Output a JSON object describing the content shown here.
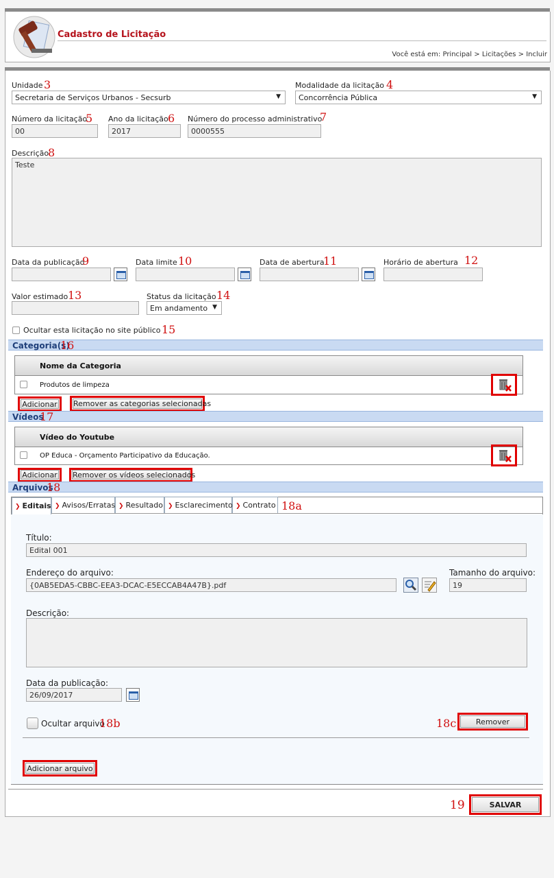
{
  "header": {
    "title": "Cadastro de Licitação",
    "breadcrumb": "Você está em: Principal > Licitações > Incluir"
  },
  "form": {
    "unidade": {
      "label": "Unidade",
      "value": "Secretaria de Serviços Urbanos - Secsurb"
    },
    "modalidade": {
      "label": "Modalidade da licitação",
      "value": "Concorrência Pública"
    },
    "numero": {
      "label": "Número da licitação",
      "value": "00"
    },
    "ano": {
      "label": "Ano da licitação",
      "value": "2017"
    },
    "processo": {
      "label": "Número do processo administrativo",
      "value": "0000555"
    },
    "descricao": {
      "label": "Descrição",
      "value": "Teste"
    },
    "data_publicacao": {
      "label": "Data da publicação",
      "value": ""
    },
    "data_limite": {
      "label": "Data limite",
      "value": ""
    },
    "data_abertura": {
      "label": "Data de abertura",
      "value": ""
    },
    "horario_abertura": {
      "label": "Horário de abertura",
      "value": ""
    },
    "valor_estimado": {
      "label": "Valor estimado",
      "value": ""
    },
    "status": {
      "label": "Status da licitação",
      "value": "Em andamento"
    },
    "ocultar": {
      "label": "Ocultar esta licitação no site público"
    }
  },
  "categorias": {
    "section": "Categoria(s)",
    "header": "Nome da Categoria",
    "rows": [
      "Produtos de limpeza"
    ],
    "add_button": "Adicionar",
    "remove_button": "Remover as categorias selecionadas"
  },
  "videos": {
    "section": "Vídeos",
    "header": "Vídeo do Youtube",
    "rows": [
      "OP Educa - Orçamento Participativo da Educação."
    ],
    "add_button": "Adicionar",
    "remove_button": "Remover os vídeos selecionados"
  },
  "arquivos": {
    "section": "Arquivos",
    "tabs": [
      "Editais",
      "Avisos/Erratas",
      "Resultado",
      "Esclarecimento",
      "Contrato"
    ],
    "titulo_label": "Título:",
    "titulo_value": "Edital 001",
    "endereco_label": "Endereço do arquivo:",
    "endereco_value": "{0AB5EDA5-CBBC-EEA3-DCAC-E5ECCAB4A47B}.pdf",
    "tamanho_label": "Tamanho do arquivo:",
    "tamanho_value": "19",
    "descricao_label": "Descrição:",
    "data_label": "Data da publicação:",
    "data_value": "26/09/2017",
    "ocultar_label": "Ocultar arquivo",
    "remover_button": "Remover",
    "adicionar_button": "Adicionar arquivo"
  },
  "salvar_button": "SALVAR",
  "annotations": {
    "a3": "3",
    "a4": "4",
    "a5": "5",
    "a6": "6",
    "a7": "7",
    "a8": "8",
    "a9": "9",
    "a10": "10",
    "a11": "11",
    "a12": "12",
    "a13": "13",
    "a14": "14",
    "a15": "15",
    "a16": "16",
    "a17": "17",
    "a18": "18",
    "a18a": "18a",
    "a18b": "18b",
    "a18c": "18c",
    "a19": "19"
  },
  "icons": {
    "logo": "gavel-icon",
    "calendar": "calendar-icon",
    "trash": "trash-delete-icon",
    "search": "magnifier-icon",
    "edit": "edit-pencil-icon",
    "dropdown": "chevron-down-icon"
  }
}
